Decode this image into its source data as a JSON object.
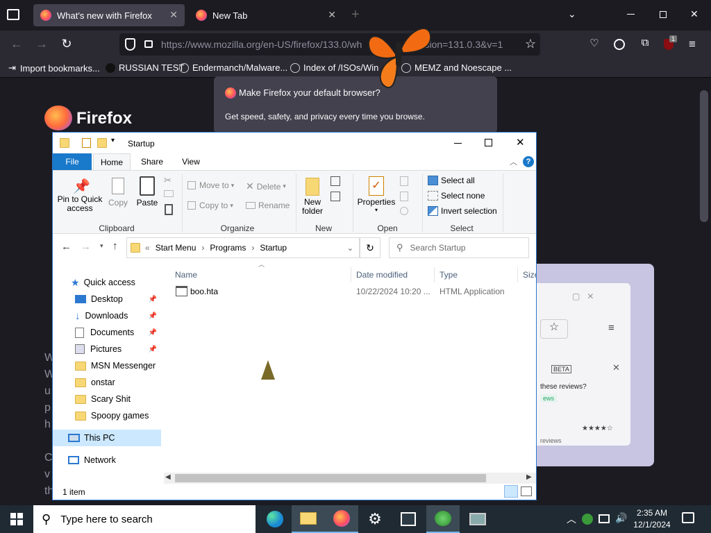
{
  "browser": {
    "tabs": [
      {
        "title": "What's new with Firefox",
        "active": true
      },
      {
        "title": "New Tab",
        "active": false
      }
    ],
    "url": "https://www.mozilla.org/en-US/firefox/133.0/wh",
    "url_tail": "version=131.0.3&v=1",
    "extension_badge": "1",
    "bookmarks": [
      {
        "label": "Import bookmarks..."
      },
      {
        "label": "RUSSIAN TEST"
      },
      {
        "label": "Endermanch/Malware..."
      },
      {
        "label": "Index of /ISOs/Win"
      },
      {
        "label": "MEMZ and Noescape ..."
      }
    ],
    "page": {
      "logo_text": "Firefox"
    },
    "notification": {
      "title": "Make Firefox your default browser?",
      "body": "Get speed, safety, and privacy every time you browse."
    },
    "background_preview": {
      "badge": "BETA",
      "question": "these reviews?",
      "link": "ews",
      "reviews": "reviews",
      "stars": "★★★★☆"
    }
  },
  "explorer": {
    "window_title": "Startup",
    "ribbon_tabs": [
      "File",
      "Home",
      "Share",
      "View"
    ],
    "clipboard": {
      "pin": "Pin to Quick access",
      "copy": "Copy",
      "paste": "Paste",
      "label": "Clipboard"
    },
    "organize": {
      "move_to": "Move to",
      "copy_to": "Copy to",
      "delete": "Delete",
      "rename": "Rename",
      "label": "Organize"
    },
    "new": {
      "new_folder": "New folder",
      "label": "New"
    },
    "open": {
      "properties": "Properties",
      "label": "Open"
    },
    "select": {
      "select_all": "Select all",
      "select_none": "Select none",
      "invert": "Invert selection",
      "label": "Select"
    },
    "breadcrumb": [
      "Start Menu",
      "Programs",
      "Startup"
    ],
    "search_placeholder": "Search Startup",
    "columns": [
      "Name",
      "Date modified",
      "Type",
      "Size"
    ],
    "files": [
      {
        "name": "boo.hta",
        "date": "10/22/2024 10:20 ...",
        "type": "HTML Application"
      }
    ],
    "nav": {
      "quick_access": "Quick access",
      "items": [
        {
          "label": "Desktop",
          "pinned": true
        },
        {
          "label": "Downloads",
          "pinned": true
        },
        {
          "label": "Documents",
          "pinned": true
        },
        {
          "label": "Pictures",
          "pinned": true
        },
        {
          "label": "MSN Messenger",
          "pinned": false
        },
        {
          "label": "onstar",
          "pinned": false
        },
        {
          "label": "Scary Shit",
          "pinned": false
        },
        {
          "label": "Spoopy games",
          "pinned": false
        }
      ],
      "this_pc": "This PC",
      "network": "Network"
    },
    "status": "1 item"
  },
  "taskbar": {
    "search_placeholder": "Type here to search",
    "time": "2:35 AM",
    "date": "12/1/2024"
  },
  "colors": {
    "firefox_bg": "#1c1b22",
    "toolbar": "#2b2a33",
    "file_tab": "#1979ca",
    "taskbar": "#1f2a33"
  }
}
